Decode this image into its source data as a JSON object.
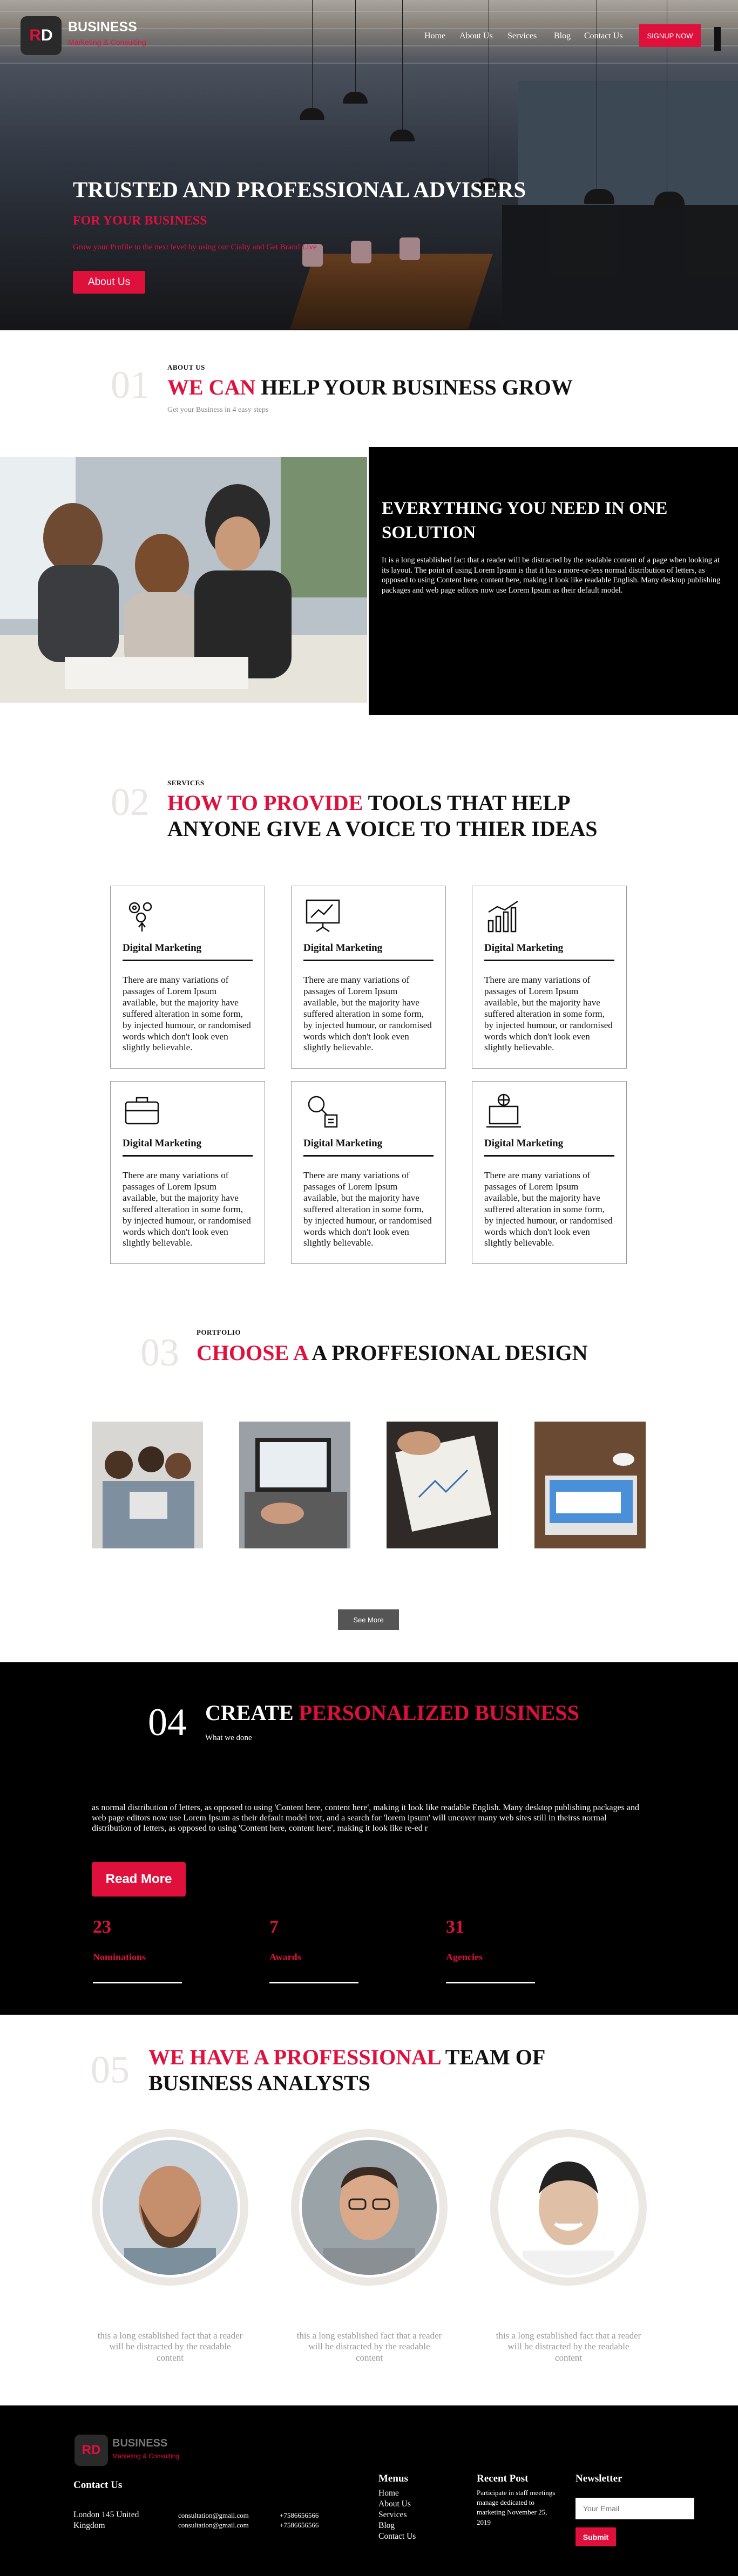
{
  "brand": {
    "mark_r": "R",
    "mark_d": "D",
    "name": "BUSINESS",
    "sub": "Marketing & Consulting"
  },
  "nav": {
    "items": [
      "Home",
      "About Us",
      "Services",
      "Blog",
      "Contact Us"
    ],
    "signup": "SIGNUP NOW"
  },
  "hero": {
    "title": "TRUSTED AND PROFESSIONAL ADVISERS",
    "subtitle": "FOR YOUR BUSINESS",
    "line": "Grow your Profile to the next level by using our Cialty and Get Brand Live",
    "button": "About Us"
  },
  "about": {
    "num": "01",
    "eyebrow": "ABOUT US",
    "title_red": "WE CAN",
    "title_rest": " HELP YOUR BUSINESS GROW",
    "sub": "Get your Business in 4 easy steps"
  },
  "solution": {
    "title": "EVERYTHING YOU NEED IN ONE SOLUTION",
    "text": "It is a long established fact that a reader will be distracted by the readable content of a page when looking at its layout. The point of using Lorem Ipsum is that it has a more-or-less normal distribution of letters, as opposed to using Content here, content here, making it look like readable English. Many desktop publishing packages and web page editors now use Lorem Ipsum as their default model."
  },
  "services": {
    "num": "02",
    "eyebrow": "SERVICES",
    "title_red": "HOW TO PROVIDE",
    "title_rest": " TOOLS THAT HELP",
    "title_line2": "ANYONE GIVE A VOICE TO THIER IDEAS",
    "cards": [
      {
        "icon": "gears-icon",
        "title": "Digital Marketing",
        "text": "There are many variations of passages of Lorem Ipsum available, but the majority have suffered alteration in some form, by injected humour, or randomised words which don't look even slightly believable."
      },
      {
        "icon": "presentation-chart-icon",
        "title": "Digital Marketing",
        "text": "There are many variations of passages of Lorem Ipsum available, but the majority have suffered alteration in some form, by injected humour, or randomised words which don't look even slightly believable."
      },
      {
        "icon": "bar-chart-growth-icon",
        "title": "Digital Marketing",
        "text": "There are many variations of passages of Lorem Ipsum available, but the majority have suffered alteration in some form, by injected humour, or randomised words which don't look even slightly believable."
      },
      {
        "icon": "briefcase-icon",
        "title": "Digital Marketing",
        "text": "There are many variations of passages of Lorem Ipsum available, but the majority have suffered alteration in some form, by injected humour, or randomised words which don't look even slightly believable."
      },
      {
        "icon": "search-analytics-icon",
        "title": "Digital Marketing",
        "text": "There are many variations of passages of Lorem Ipsum available, but the majority have suffered alteration in some form, by injected humour, or randomised words which don't look even slightly believable."
      },
      {
        "icon": "global-laptop-icon",
        "title": "Digital Marketing",
        "text": "There are many variations of passages of Lorem Ipsum available, but the majority have suffered alteration in some form, by injected humour, or randomised words which don't look even slightly believable."
      }
    ]
  },
  "portfolio": {
    "num": "03",
    "eyebrow": "PORTFOLIO",
    "title_red": "CHOOSE A",
    "title_rest": " A PROFFESIONAL DESIGN",
    "see_more": "See More"
  },
  "create": {
    "num": "04",
    "title_white": "CREATE ",
    "title_red": "PERSONALIZED BUSINESS",
    "sub": "What we done",
    "text": "as normal distribution of letters, as opposed to using 'Content here, content here', making it look like readable English. Many desktop publishing packages and web page editors now use Lorem Ipsum as their default model text, and a search for 'lorem ipsum' will uncover many web sites still in theirss normal distribution of letters, as opposed to using 'Content here, content here', making it look like re-ed r",
    "button": "Read More",
    "stats": [
      {
        "num": "23",
        "label": "Nominations"
      },
      {
        "num": "7",
        "label": "Awards"
      },
      {
        "num": "31",
        "label": "Agencies"
      }
    ]
  },
  "team": {
    "num": "05",
    "title_red": "WE HAVE A PROFESSIONAL",
    "title_rest": " TEAM OF",
    "title_line2": "BUSINESS ANALYSTS",
    "captions": [
      "this a long established fact that a reader will be distracted by the readable content",
      "this a long established fact that a reader will be distracted by the readable content",
      "this a long established fact that a reader will be distracted by the readable content"
    ]
  },
  "footer": {
    "contact_heading": "Contact Us",
    "address": "London 145 United Kingdom",
    "emails": [
      "consultation@gmail.com",
      "consultation@gmail.com"
    ],
    "phones": [
      "+7586656566",
      "+7586656566"
    ],
    "menus_heading": "Menus",
    "menus": [
      "Home",
      "About Us",
      "Services",
      "Blog",
      "Contact Us"
    ],
    "recent_heading": "Recent Post",
    "recent_post": "Participate in staff meetings manage dedicated to marketing November 25, 2019",
    "newsletter_heading": "Newsletter",
    "newsletter_placeholder": "Your Email",
    "submit": "Submit"
  },
  "colors": {
    "accent": "#e0103d",
    "dark": "#000000",
    "muted": "#999999"
  }
}
